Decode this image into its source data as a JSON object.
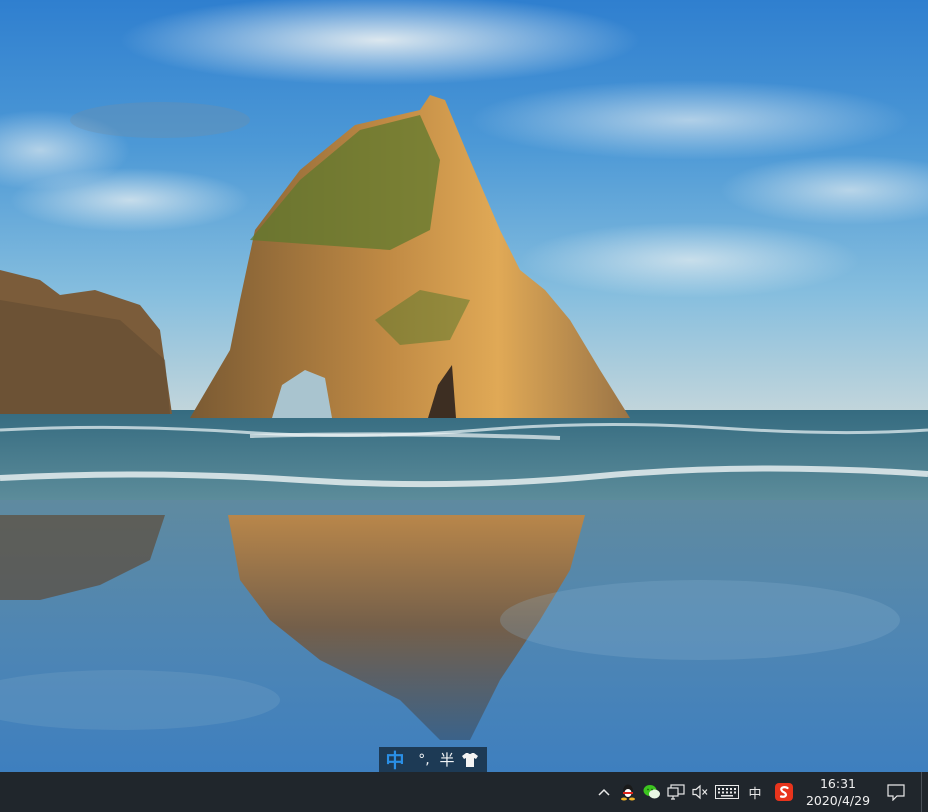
{
  "desktop": {
    "wallpaper": "windows-10-beach-rock-arch"
  },
  "ime_bar": {
    "lang_mode": "中",
    "punctuation": "°,",
    "width_mode": "半",
    "skin_icon": "tshirt-icon"
  },
  "taskbar": {
    "background": "#20262c",
    "tray": {
      "chevron_icon": "chevron-up-icon",
      "icons": [
        "qq-icon",
        "wechat-icon",
        "network-icon",
        "volume-muted-icon",
        "keyboard-icon"
      ],
      "input_lang": "中",
      "sogou_icon": "sogou-ime-icon"
    },
    "clock": {
      "time": "16:31",
      "date": "2020/4/29"
    },
    "notification_icon": "action-center-icon"
  },
  "colors": {
    "ime_accent": "#2a8fe6",
    "sogou_red": "#e8341c"
  }
}
